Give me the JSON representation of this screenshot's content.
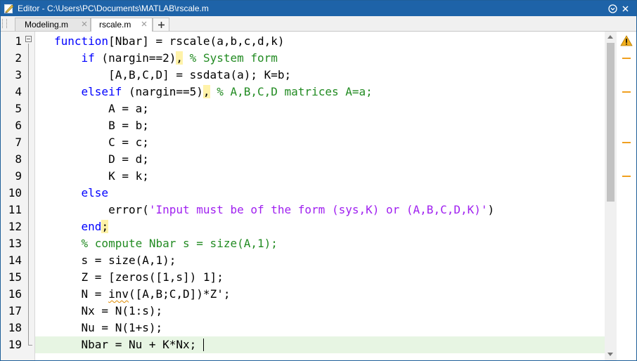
{
  "window": {
    "title": "Editor - C:\\Users\\PC\\Documents\\MATLAB\\rscale.m",
    "colors": {
      "titlebar": "#1e63a8",
      "current_line": "#e7f5e3",
      "highlight": "#fff2a8",
      "warning": "#f0a020"
    }
  },
  "tabs": [
    {
      "label": "Modeling.m",
      "active": false
    },
    {
      "label": "rscale.m",
      "active": true
    }
  ],
  "icons": {
    "window": "matlab-editor-icon",
    "menu": "chevron-down-circle-icon",
    "close": "close-icon",
    "tab_close": "close-icon",
    "add_tab": "plus-icon",
    "fold": "fold-toggle-icon",
    "warning": "warning-triangle-icon"
  },
  "editor": {
    "current_line": 19,
    "lines": [
      {
        "n": "1",
        "parts": [
          [
            "kw",
            "function"
          ],
          [
            "",
            "[Nbar] = rscale(a,b,c,d,k)"
          ]
        ]
      },
      {
        "n": "2",
        "parts": [
          [
            "",
            "    "
          ],
          [
            "kw",
            "if"
          ],
          [
            "",
            " (nargin==2)"
          ],
          [
            "hl",
            ","
          ],
          [
            "",
            " "
          ],
          [
            "cm",
            "% System form"
          ]
        ]
      },
      {
        "n": "3",
        "parts": [
          [
            "",
            "        [A,B,C,D] = ssdata(a); K=b;"
          ]
        ]
      },
      {
        "n": "4",
        "parts": [
          [
            "",
            "    "
          ],
          [
            "kw",
            "elseif"
          ],
          [
            "",
            " (nargin==5)"
          ],
          [
            "hl",
            ","
          ],
          [
            "",
            " "
          ],
          [
            "cm",
            "% A,B,C,D matrices A=a;"
          ]
        ]
      },
      {
        "n": "5",
        "parts": [
          [
            "",
            "        A = a;"
          ]
        ]
      },
      {
        "n": "6",
        "parts": [
          [
            "",
            "        B = b;"
          ]
        ]
      },
      {
        "n": "7",
        "parts": [
          [
            "",
            "        C = c;"
          ]
        ]
      },
      {
        "n": "8",
        "parts": [
          [
            "",
            "        D = d;"
          ]
        ]
      },
      {
        "n": "9",
        "parts": [
          [
            "",
            "        K = k;"
          ]
        ]
      },
      {
        "n": "10",
        "parts": [
          [
            "",
            "    "
          ],
          [
            "kw",
            "else"
          ]
        ]
      },
      {
        "n": "11",
        "parts": [
          [
            "",
            "        error("
          ],
          [
            "st",
            "'Input must be of the form (sys,K) or (A,B,C,D,K)'"
          ],
          [
            "",
            ")"
          ]
        ]
      },
      {
        "n": "12",
        "parts": [
          [
            "",
            "    "
          ],
          [
            "kw",
            "end"
          ],
          [
            "hl",
            ";"
          ]
        ]
      },
      {
        "n": "13",
        "parts": [
          [
            "",
            "    "
          ],
          [
            "cm",
            "% compute Nbar s = size(A,1);"
          ]
        ]
      },
      {
        "n": "14",
        "parts": [
          [
            "",
            "    s = size(A,1);"
          ]
        ]
      },
      {
        "n": "15",
        "parts": [
          [
            "",
            "    Z = [zeros([1,s]) 1];"
          ]
        ]
      },
      {
        "n": "16",
        "parts": [
          [
            "",
            "    N = "
          ],
          [
            "squig",
            "inv"
          ],
          [
            "",
            "([A,B;C,D])*Z';"
          ]
        ]
      },
      {
        "n": "17",
        "parts": [
          [
            "",
            "    Nx = N(1:s);"
          ]
        ]
      },
      {
        "n": "18",
        "parts": [
          [
            "",
            "    Nu = N(1+s);"
          ]
        ]
      },
      {
        "n": "19",
        "parts": [
          [
            "",
            "    Nbar = Nu + K*Nx; "
          ]
        ]
      }
    ]
  },
  "warning_markers_lines": [
    2,
    4,
    7,
    9
  ]
}
